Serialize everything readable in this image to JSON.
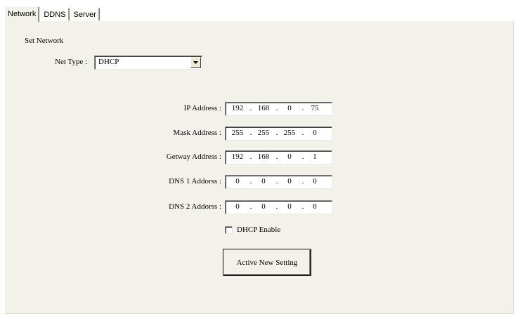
{
  "tabs": [
    {
      "label": "Network",
      "active": true
    },
    {
      "label": "DDNS",
      "active": false
    },
    {
      "label": "Server",
      "active": false
    }
  ],
  "section_label": "Set Network",
  "net_type": {
    "label": "Net Type :",
    "value": "DHCP"
  },
  "fields": [
    {
      "label": "IP Address :",
      "octets": [
        "192",
        "168",
        "0",
        "75"
      ]
    },
    {
      "label": "Mask Address :",
      "octets": [
        "255",
        "255",
        "255",
        "0"
      ]
    },
    {
      "label": "Getway Address :",
      "octets": [
        "192",
        "168",
        "0",
        "1"
      ]
    },
    {
      "label": "DNS 1 Addorss :",
      "octets": [
        "0",
        "0",
        "0",
        "0"
      ]
    },
    {
      "label": "DNS 2 Addorss :",
      "octets": [
        "0",
        "0",
        "0",
        "0"
      ]
    }
  ],
  "dhcp_enable": {
    "label": "DHCP Enable",
    "checked": false
  },
  "apply_button_label": "Active New Setting"
}
